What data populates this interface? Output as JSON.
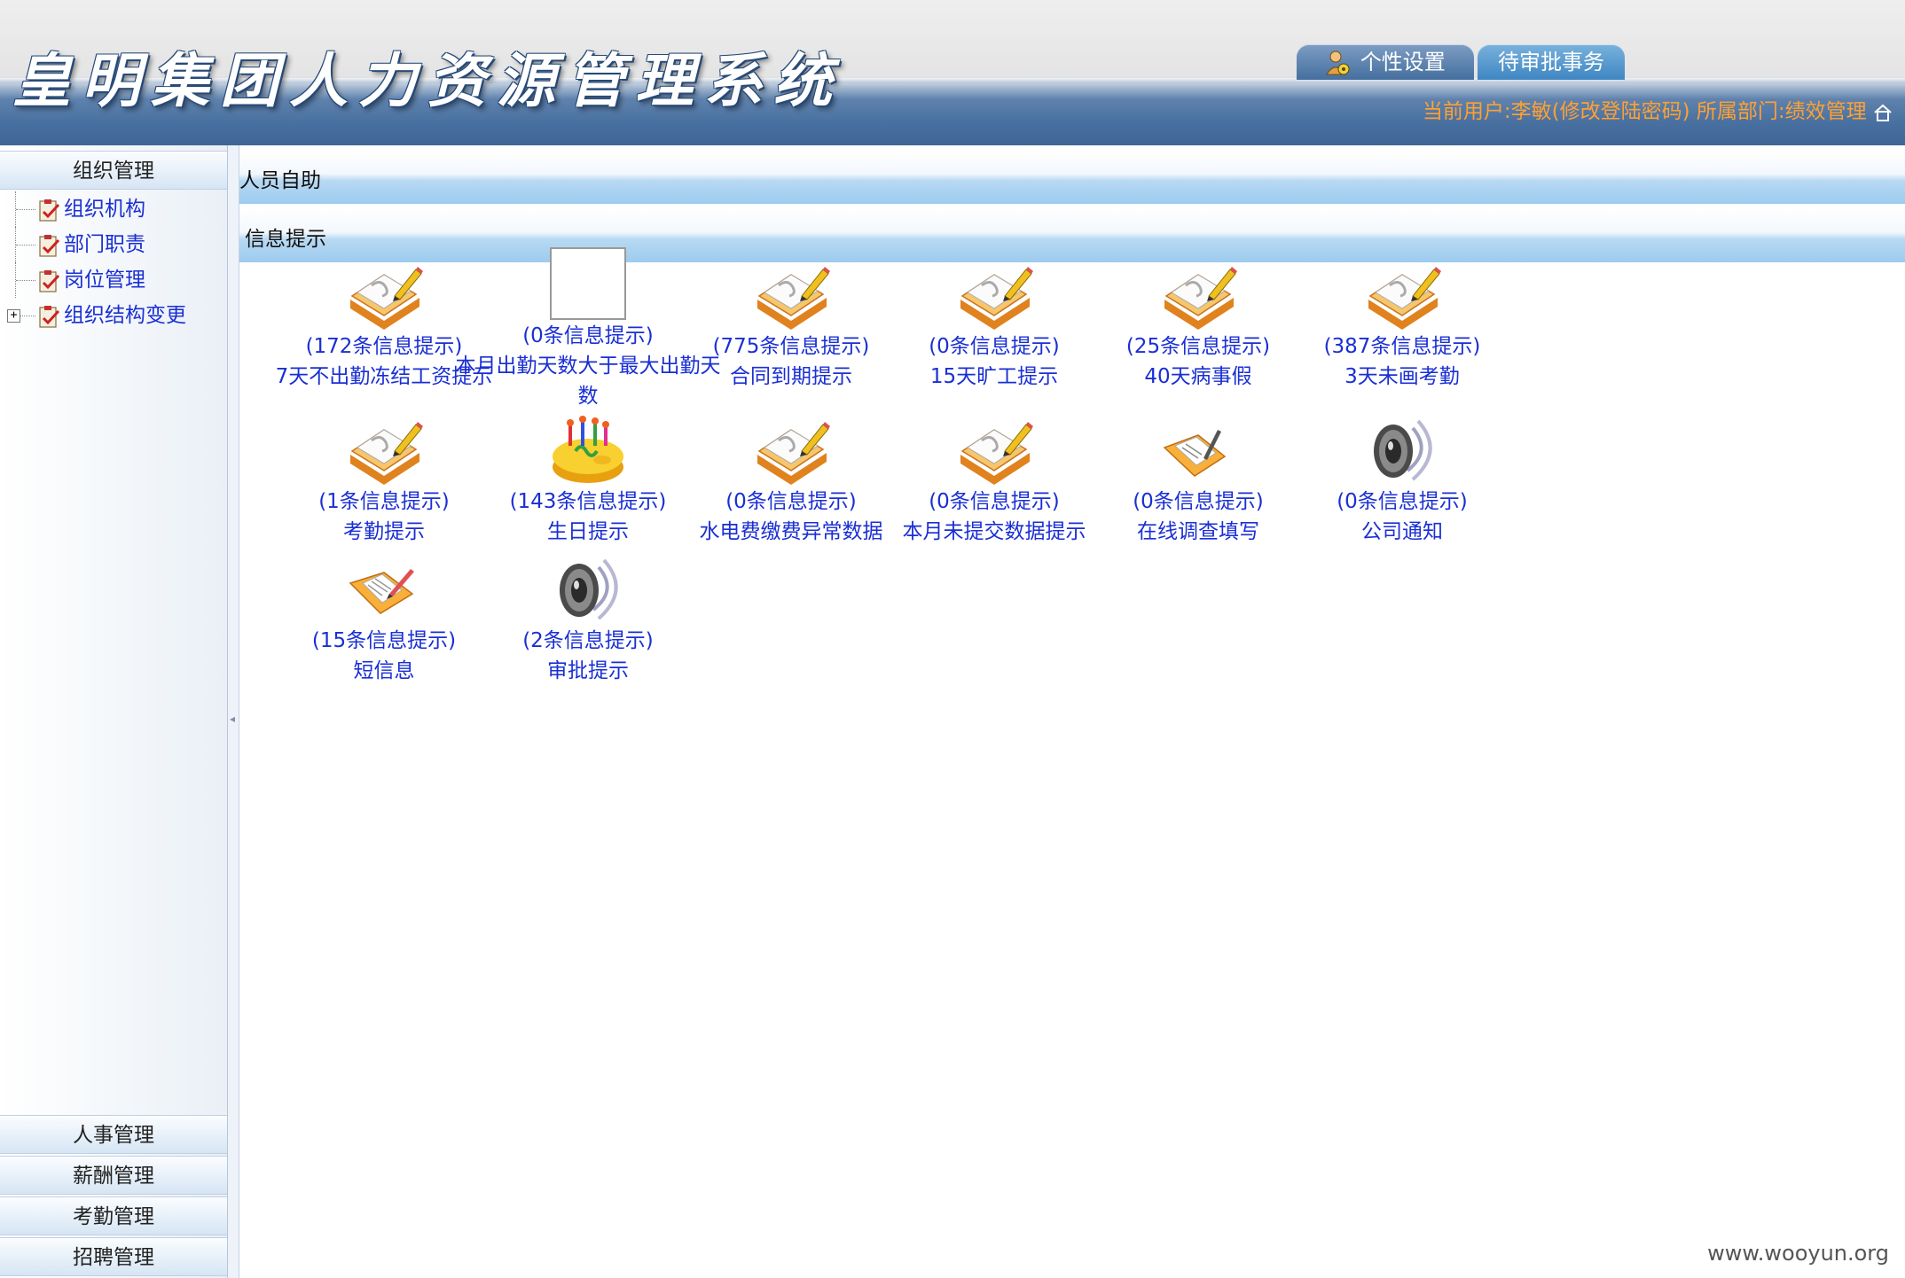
{
  "header": {
    "title": "皇明集团人力资源管理系统",
    "tabs": [
      {
        "label": "个性设置",
        "icon": "user-settings-icon"
      },
      {
        "label": "待审批事务"
      }
    ],
    "user_info": "当前用户:李敏(修改登陆密码) 所属部门:绩效管理"
  },
  "sidebar": {
    "active_section": "组织管理",
    "items": [
      {
        "label": "组织机构"
      },
      {
        "label": "部门职责"
      },
      {
        "label": "岗位管理"
      },
      {
        "label": "组织结构变更",
        "expander": "+"
      }
    ],
    "sections": [
      "人事管理",
      "薪酬管理",
      "考勤管理",
      "招聘管理"
    ]
  },
  "main": {
    "section1": "人员自助",
    "section2": "信息提示",
    "tiles": [
      {
        "count": "(172条信息提示)",
        "label": "7天不出勤冻结工资提示",
        "icon": "notebook-pencil-icon"
      },
      {
        "count": "(0条信息提示)",
        "label": "本月出勤天数大于最大出勤天数",
        "icon": "missing-image-icon"
      },
      {
        "count": "(775条信息提示)",
        "label": "合同到期提示",
        "icon": "notebook-pencil-icon"
      },
      {
        "count": "(0条信息提示)",
        "label": "15天旷工提示",
        "icon": "notebook-pencil-icon"
      },
      {
        "count": "(25条信息提示)",
        "label": "40天病事假",
        "icon": "notebook-pencil-icon"
      },
      {
        "count": "(387条信息提示)",
        "label": "3天未画考勤",
        "icon": "notebook-pencil-icon"
      },
      {
        "count": "(1条信息提示)",
        "label": "考勤提示",
        "icon": "notebook-pencil-icon"
      },
      {
        "count": "(143条信息提示)",
        "label": "生日提示",
        "icon": "birthday-cake-icon"
      },
      {
        "count": "(0条信息提示)",
        "label": "水电费缴费异常数据",
        "icon": "notebook-pencil-icon"
      },
      {
        "count": "(0条信息提示)",
        "label": "本月未提交数据提示",
        "icon": "notebook-pencil-icon"
      },
      {
        "count": "(0条信息提示)",
        "label": "在线调查填写",
        "icon": "survey-folder-icon"
      },
      {
        "count": "(0条信息提示)",
        "label": "公司通知",
        "icon": "speaker-icon"
      },
      {
        "count": "(15条信息提示)",
        "label": "短信息",
        "icon": "message-folder-icon"
      },
      {
        "count": "(2条信息提示)",
        "label": "审批提示",
        "icon": "speaker-icon"
      }
    ]
  },
  "watermark": "www.wooyun.org",
  "colors": {
    "link": "#1a2fd4",
    "user_info": "#ffa032",
    "header_blue": "#476f9f"
  }
}
